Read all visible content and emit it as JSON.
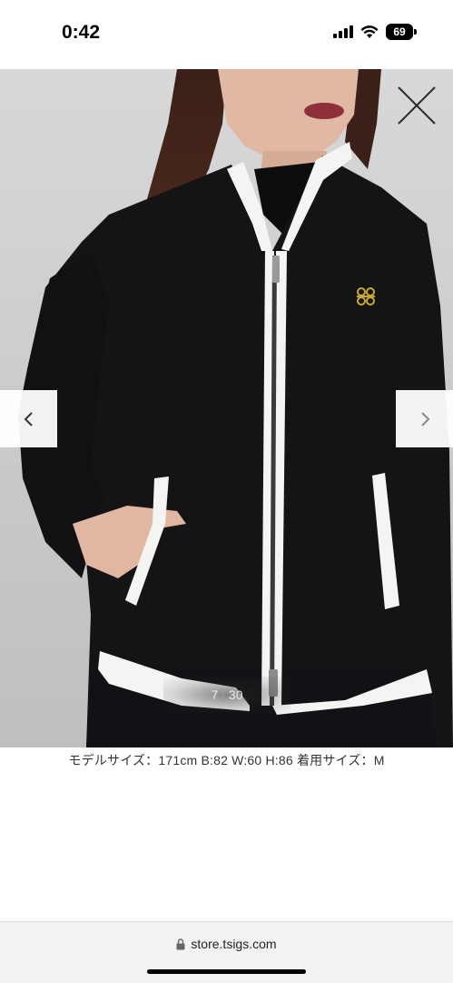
{
  "status_bar": {
    "time": "0:42",
    "battery": "69",
    "icons": [
      "cellular-signal-icon",
      "wifi-icon",
      "battery-icon"
    ]
  },
  "gallery": {
    "image_description_icon": "product-photo",
    "counter_current": "7",
    "counter_total": "30",
    "counter_separator": "|",
    "prev_icon": "chevron-left-icon",
    "next_icon": "chevron-right-icon",
    "close_icon": "close-icon"
  },
  "caption": "モデルサイズ：171cm B:82 W:60 H:86 着用サイズ：M",
  "browser": {
    "url": "store.tsigs.com",
    "lock_icon": "lock-icon"
  },
  "colors": {
    "jacket": "#141416",
    "trim": "#f4f4f2",
    "background": "#ffffff",
    "gallery_bg": "#d0d0d0"
  }
}
